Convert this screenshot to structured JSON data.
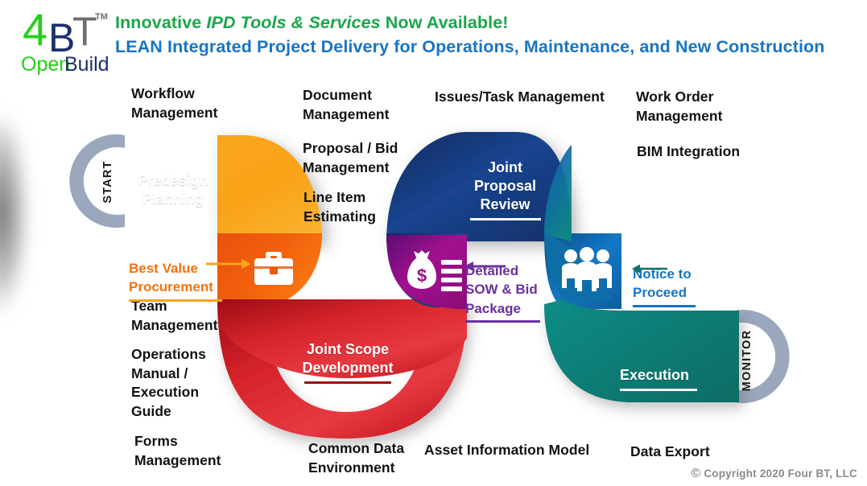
{
  "logo": {
    "char_4": "4",
    "char_B": "B",
    "char_T": "T",
    "tm": "TM",
    "word_open": "Open",
    "word_build": "Build",
    "colors": {
      "green": "#23d018",
      "navy": "#1b2f6b",
      "gray": "#6e6e6e"
    }
  },
  "headline": {
    "line1_part1": "Innovative ",
    "line1_italic": "IPD Tools & Services",
    "line1_part2": " Now Available!",
    "line2": "LEAN Integrated Project Delivery for Operations, Maintenance, and New Construction",
    "line1_color": "#1aa64b",
    "line2_color": "#1874c4"
  },
  "feature_labels": [
    {
      "id": "workflow-management",
      "text": "Workflow\nManagement"
    },
    {
      "id": "document-management",
      "text": "Document\nManagement"
    },
    {
      "id": "issues-task-management",
      "text": "Issues/Task Management"
    },
    {
      "id": "work-order-management",
      "text": "Work Order\nManagement"
    },
    {
      "id": "proposal-bid-management",
      "text": "Proposal / Bid\nManagement"
    },
    {
      "id": "bim-integration",
      "text": "BIM Integration"
    },
    {
      "id": "line-item-estimating",
      "text": "Line Item\nEstimating"
    },
    {
      "id": "team-management",
      "text": "Team\nManagement"
    },
    {
      "id": "operations-manual",
      "text": "Operations\nManual /\nExecution\nGuide"
    },
    {
      "id": "forms-management",
      "text": "Forms\nManagement"
    },
    {
      "id": "common-data-environment",
      "text": "Common Data\nEnvironment"
    },
    {
      "id": "asset-information-model",
      "text": "Asset Information Model"
    },
    {
      "id": "data-export",
      "text": "Data Export"
    }
  ],
  "callouts": [
    {
      "id": "best-value-procurement",
      "text": "Best Value\nProcurement",
      "color": "#F27312",
      "rule_color": "#F9A31A",
      "arrow": "right",
      "arrow_color": "#F9A31A"
    },
    {
      "id": "detailed-sow-bid-package",
      "text": "Detailed\nSOW & Bid\nPackage",
      "color": "#6B2FA0",
      "rule_color": "#6B2FA0",
      "arrow": "left",
      "arrow_color": "#6B2FA0"
    },
    {
      "id": "notice-to-proceed",
      "text": "Notice to\nProceed",
      "color": "#1874C4",
      "rule_color": "#1874C4",
      "arrow": "left",
      "arrow_color": "#12706A"
    }
  ],
  "stages": [
    {
      "id": "predesign-planning",
      "label": "Predesign\nPlanning",
      "color": "#F9A31A"
    },
    {
      "id": "joint-scope-development",
      "label": "Joint Scope\nDevelopment",
      "color": "#D8222A"
    },
    {
      "id": "joint-proposal-review",
      "label": "Joint\nProposal\nReview",
      "color": "#14357F"
    },
    {
      "id": "execution",
      "label": "Execution",
      "color": "#0C7E77"
    }
  ],
  "icons": [
    {
      "id": "briefcase-icon",
      "name": "briefcase-icon",
      "panel_color": "#F2570C"
    },
    {
      "id": "money-bag-icon",
      "name": "money-bag-icon",
      "panel_color": "#9A0E8C"
    },
    {
      "id": "people-group-icon",
      "name": "people-group-icon",
      "panel_color": "#1173BF"
    }
  ],
  "endcaps": [
    {
      "id": "start-cap",
      "text": "START",
      "ring_color": "#9AA7BD"
    },
    {
      "id": "monitor-cap",
      "text": "MONITOR",
      "ring_color": "#9AA7BD"
    }
  ],
  "footer": {
    "copyright_symbol": "©",
    "copyright_text": "Copyright 2020 Four BT, LLC",
    "color": "#8a8a8a"
  }
}
